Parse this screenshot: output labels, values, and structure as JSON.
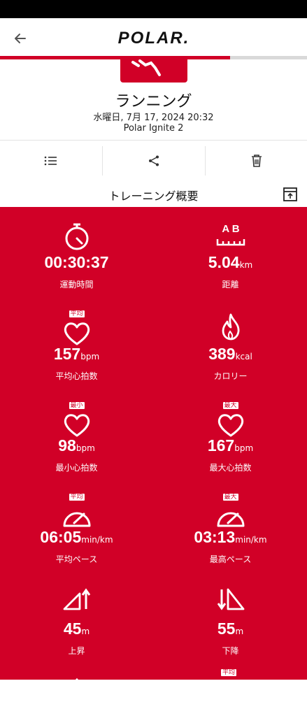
{
  "header": {
    "sport": "ランニング",
    "date": "水曜日, 7月 17, 2024 20:32",
    "device": "Polar Ignite 2",
    "logo": "POLAR."
  },
  "progress": 0.75,
  "section": {
    "title": "トレーニング概要"
  },
  "stats": [
    {
      "icon": "stopwatch-icon",
      "value": "00:30:37",
      "unit": "",
      "label": "運動時間",
      "tag": ""
    },
    {
      "icon": "distance-icon",
      "value": "5.04",
      "unit": "km",
      "label": "距離",
      "tag": "",
      "icon_text": "A  B"
    },
    {
      "icon": "heart-icon",
      "value": "157",
      "unit": "bpm",
      "label": "平均心拍数",
      "tag": "平均"
    },
    {
      "icon": "flame-icon",
      "value": "389",
      "unit": "kcal",
      "label": "カロリー",
      "tag": ""
    },
    {
      "icon": "heart-icon",
      "value": "98",
      "unit": "bpm",
      "label": "最小心拍数",
      "tag": "最小"
    },
    {
      "icon": "heart-icon",
      "value": "167",
      "unit": "bpm",
      "label": "最大心拍数",
      "tag": "最大"
    },
    {
      "icon": "gauge-icon",
      "value": "06:05",
      "unit": "min/km",
      "label": "平均ペース",
      "tag": "平均"
    },
    {
      "icon": "gauge-icon",
      "value": "03:13",
      "unit": "min/km",
      "label": "最高ペース",
      "tag": "最大"
    },
    {
      "icon": "ascent-icon",
      "value": "45",
      "unit": "m",
      "label": "上昇",
      "tag": ""
    },
    {
      "icon": "descent-icon",
      "value": "55",
      "unit": "m",
      "label": "下降",
      "tag": ""
    }
  ],
  "partial_tag": "平均"
}
